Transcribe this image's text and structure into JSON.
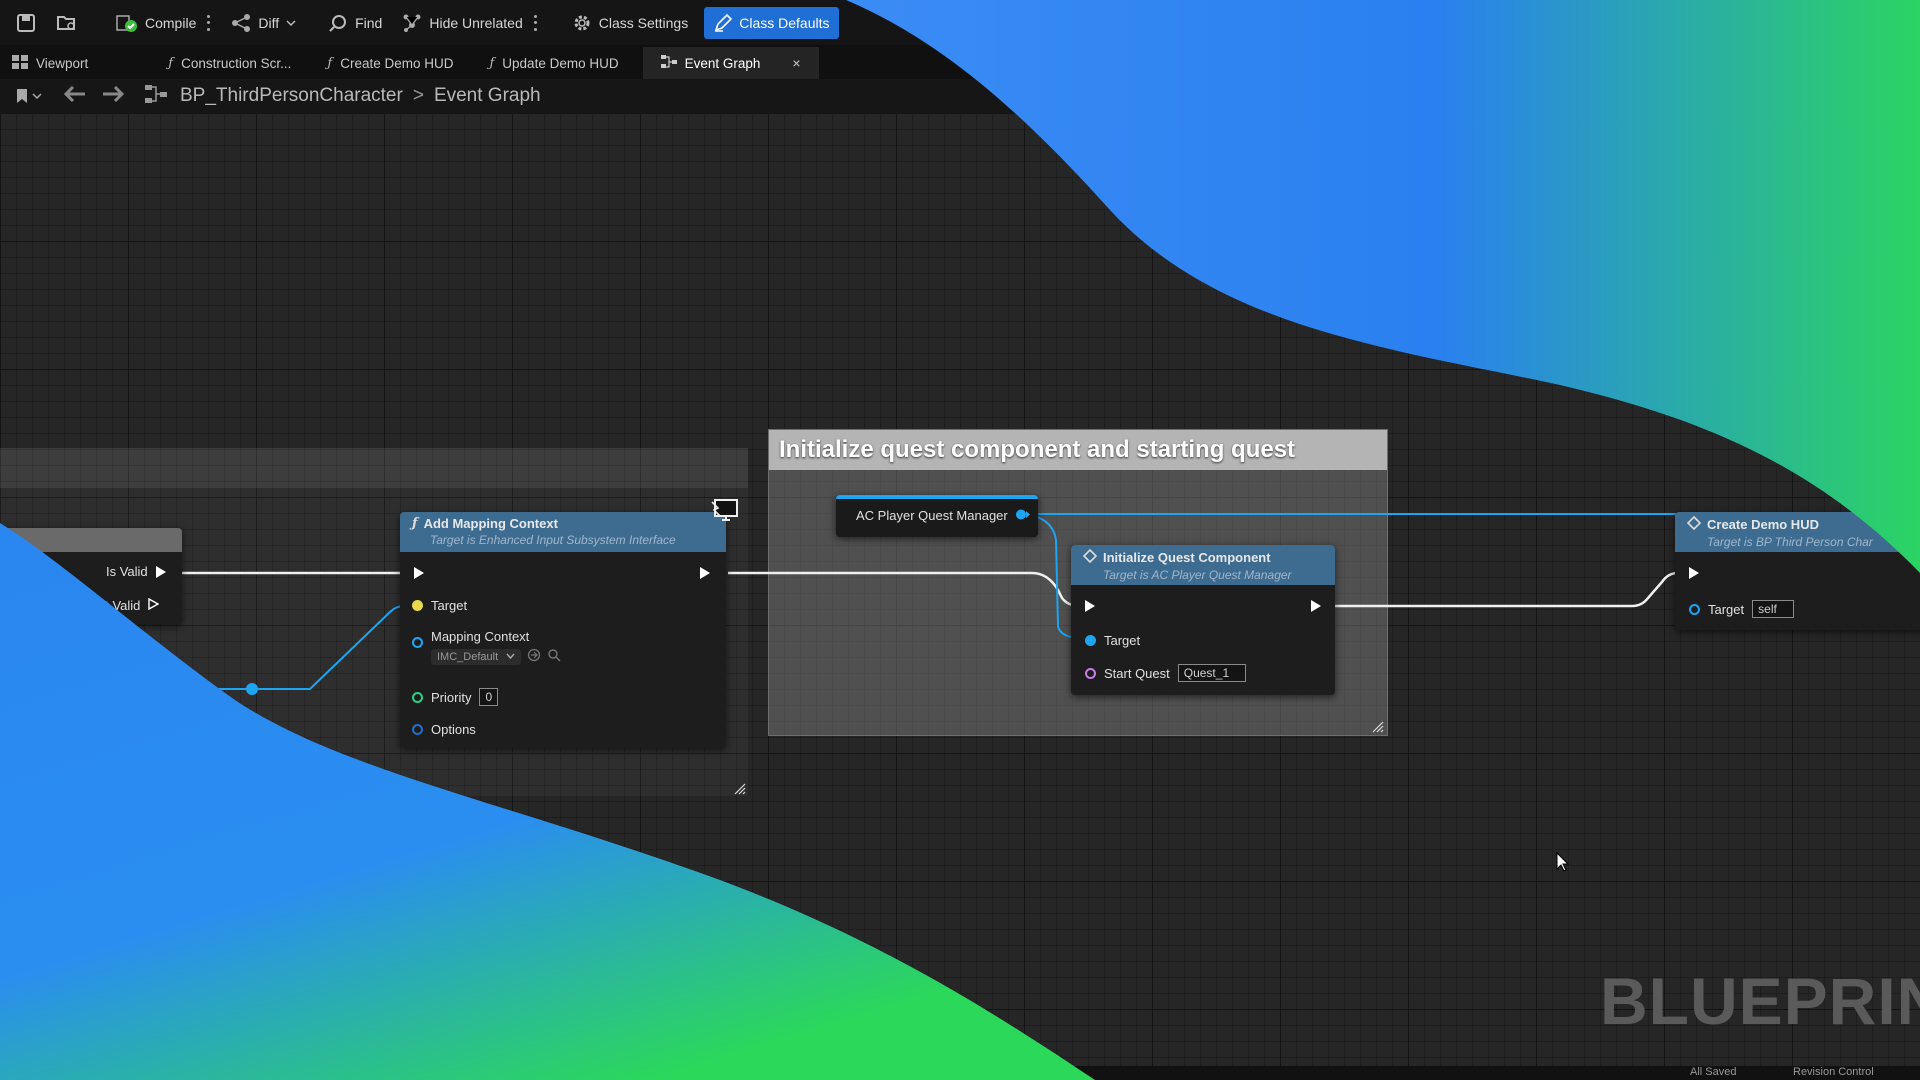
{
  "toolbar": {
    "compile": "Compile",
    "diff": "Diff",
    "find": "Find",
    "hide_unrelated": "Hide Unrelated",
    "class_settings": "Class Settings",
    "class_defaults": "Class Defaults"
  },
  "tabs": [
    {
      "label": "Viewport"
    },
    {
      "label": "Construction Scr..."
    },
    {
      "label": "Create Demo HUD"
    },
    {
      "label": "Update Demo HUD"
    },
    {
      "label": "Event Graph",
      "close": "×"
    }
  ],
  "breadcrumb": {
    "blueprint": "BP_ThirdPersonCharacter",
    "separator": ">",
    "graph": "Event Graph"
  },
  "graph": {
    "comment_title": "Initialize quest component and starting quest",
    "is_valid_node": {
      "pin_valid": "Is Valid",
      "pin_not_valid": "ot Valid"
    },
    "add_mapping_context": {
      "title": "Add Mapping Context",
      "subtitle": "Target is Enhanced Input Subsystem Interface",
      "pin_target": "Target",
      "pin_mapping_context": "Mapping Context",
      "mapping_context_value": "IMC_Default",
      "pin_priority": "Priority",
      "priority_value": "0",
      "pin_options": "Options"
    },
    "quest_manager_var": {
      "label": "AC Player Quest Manager"
    },
    "initialize_quest_component": {
      "title": "Initialize Quest Component",
      "subtitle": "Target is AC Player Quest Manager",
      "pin_target": "Target",
      "pin_start_quest": "Start Quest",
      "start_quest_value": "Quest_1"
    },
    "create_demo_hud": {
      "title": "Create Demo HUD",
      "subtitle": "Target is BP Third Person Char",
      "pin_target": "Target",
      "target_value": "self"
    }
  },
  "watermark": "BLUEPRINT",
  "status": {
    "saved": "All Saved",
    "revision": "Revision Control"
  },
  "colors": {
    "accent_blue": "#1f6fd6",
    "node_header": "#3e6c90",
    "graph_bg": "#262626",
    "blob_blue": "#2a86f0",
    "blob_green": "#2ad35a",
    "pin_object": "#1ea5f2",
    "pin_target_yellow": "#e8d84a",
    "pin_int": "#1fd68a",
    "pin_struct": "#1d6fd0",
    "pin_name": "#c77ce8"
  }
}
